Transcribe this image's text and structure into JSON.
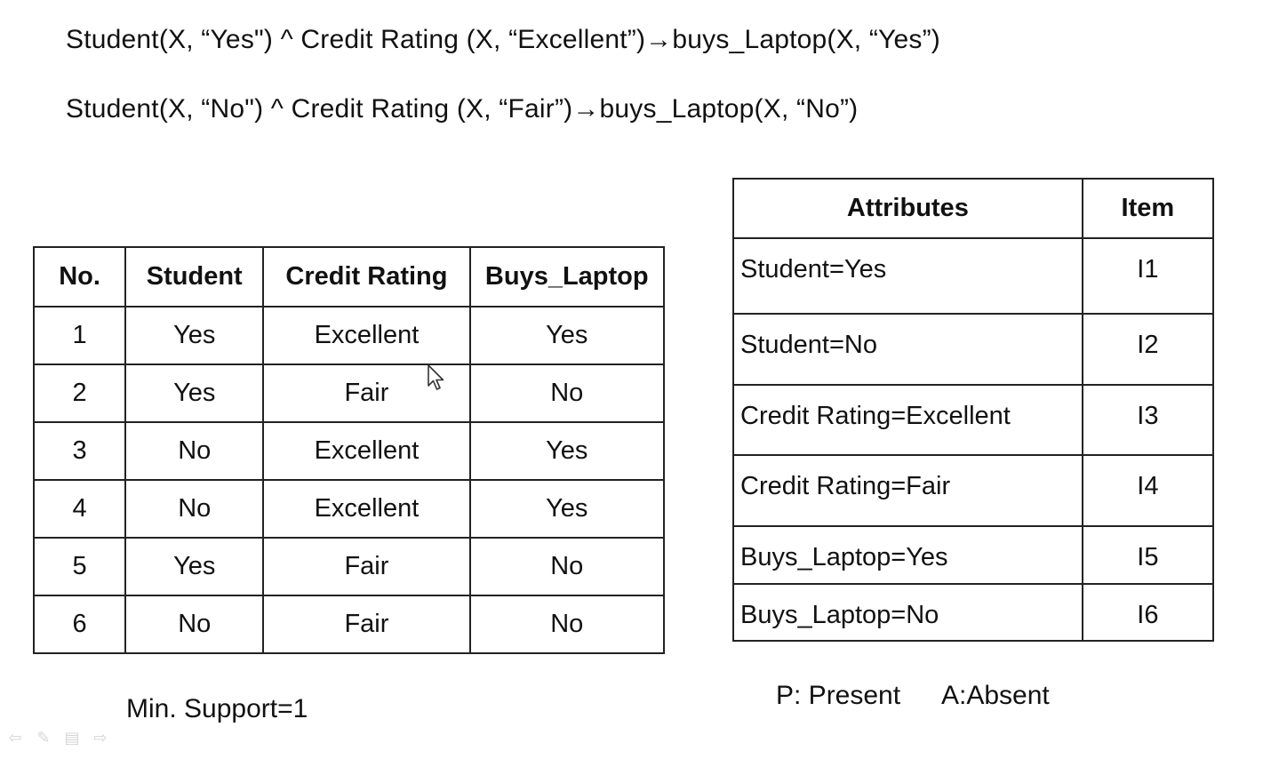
{
  "rules": [
    "Student(X, “Yes\") ^ Credit Rating (X, “Excellent”)→buys_Laptop(X, “Yes”)",
    "Student(X, “No\") ^ Credit Rating (X, “Fair”)→buys_Laptop(X, “No”)"
  ],
  "data_table": {
    "headers": [
      "No.",
      "Student",
      "Credit Rating",
      "Buys_Laptop"
    ],
    "rows": [
      [
        "1",
        "Yes",
        "Excellent",
        "Yes"
      ],
      [
        "2",
        "Yes",
        "Fair",
        "No"
      ],
      [
        "3",
        "No",
        "Excellent",
        "Yes"
      ],
      [
        "4",
        "No",
        "Excellent",
        "Yes"
      ],
      [
        "5",
        "Yes",
        "Fair",
        "No"
      ],
      [
        "6",
        "No",
        "Fair",
        "No"
      ]
    ]
  },
  "item_table": {
    "headers": [
      "Attributes",
      "Item"
    ],
    "rows": [
      [
        "Student=Yes",
        "I1"
      ],
      [
        "Student=No",
        "I2"
      ],
      [
        "Credit Rating=Excellent",
        "I3"
      ],
      [
        "Credit Rating=Fair",
        "I4"
      ],
      [
        "Buys_Laptop=Yes",
        "I5"
      ],
      [
        "Buys_Laptop=No",
        "I6"
      ]
    ]
  },
  "notes": {
    "min_support": "Min. Support=1",
    "present": "P: Present",
    "absent": "A:Absent"
  },
  "slide_controls": {
    "icons": [
      "previous-arrow-icon",
      "pen-icon",
      "menu-icon",
      "next-arrow-icon"
    ],
    "glyphs": [
      "⇦",
      "✎",
      "▤",
      "⇨"
    ]
  }
}
